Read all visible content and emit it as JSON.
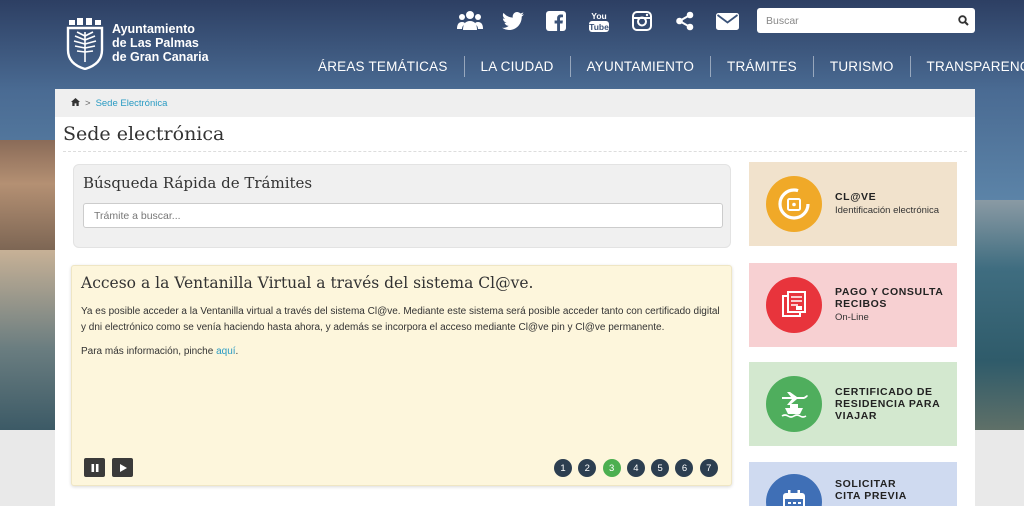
{
  "header": {
    "logo_text": [
      "Ayuntamiento",
      "de Las Palmas",
      "de Gran Canaria"
    ],
    "social_icons": [
      "people-icon",
      "twitter-icon",
      "facebook-icon",
      "youtube-icon",
      "instagram-icon",
      "share-icon",
      "mail-icon"
    ],
    "youtube_label": "You Tube",
    "search_placeholder": "Buscar",
    "nav": [
      "ÁREAS TEMÁTICAS",
      "LA CIUDAD",
      "AYUNTAMIENTO",
      "TRÁMITES",
      "TURISMO",
      "TRANSPARENCIA"
    ]
  },
  "breadcrumb": {
    "sep": ">",
    "current": "Sede Electrónica"
  },
  "page_title": "Sede electrónica",
  "quick_search": {
    "title": "Búsqueda Rápida de Trámites",
    "placeholder": "Trámite a buscar..."
  },
  "slide": {
    "title": "Acceso a la Ventanilla Virtual a través del sistema Cl@ve.",
    "body": "Ya es posible acceder a la Ventanilla virtual a través del sistema Cl@ve. Mediante este sistema será posible acceder tanto con certificado digital y dni electrónico como se venía haciendo hasta ahora, y además se incorpora el acceso mediante Cl@ve pin y Cl@ve permanente.",
    "more_prefix": "Para más información, pinche ",
    "more_link": "aquí",
    "more_suffix": ".",
    "pages": [
      "1",
      "2",
      "3",
      "4",
      "5",
      "6",
      "7"
    ],
    "active_page": "3"
  },
  "cards": [
    {
      "title": "CL@VE",
      "subtitle": "Identificación electrónica",
      "bg": "#f1e2cc",
      "circle": "#f0a928",
      "icon": "clave-icon"
    },
    {
      "title": "PAGO Y CONSULTA RECIBOS",
      "subtitle": "On-Line",
      "bg": "#f7d0d2",
      "circle": "#e8343c",
      "icon": "receipt-icon"
    },
    {
      "title": "CERTIFICADO DE RESIDENCIA PARA VIAJAR",
      "subtitle": "",
      "bg": "#d3e8cf",
      "circle": "#4fae5d",
      "icon": "plane-ship-icon"
    },
    {
      "title": "SOLICITAR CITA PREVIA",
      "subtitle": "",
      "bg": "#cfdaf0",
      "circle": "#3f6fb6",
      "icon": "calendar-icon"
    }
  ]
}
